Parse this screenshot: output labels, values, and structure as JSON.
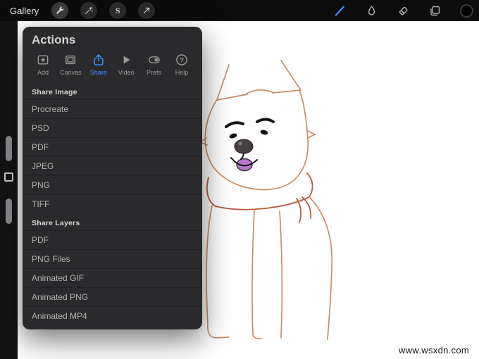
{
  "topbar": {
    "gallery_label": "Gallery",
    "left_tools": [
      "actions",
      "adjustments",
      "selection",
      "transform"
    ],
    "selection_glyph": "S",
    "right_tools": [
      "brush",
      "smudge",
      "eraser",
      "layers",
      "color"
    ]
  },
  "actions_panel": {
    "title": "Actions",
    "selected_tab": "Share",
    "tabs": [
      {
        "label": "Add"
      },
      {
        "label": "Canvas"
      },
      {
        "label": "Share"
      },
      {
        "label": "Video"
      },
      {
        "label": "Prefs"
      },
      {
        "label": "Help"
      }
    ],
    "share_image": {
      "header": "Share Image",
      "items": [
        "Procreate",
        "PSD",
        "PDF",
        "JPEG",
        "PNG",
        "TIFF"
      ]
    },
    "share_layers": {
      "header": "Share Layers",
      "items": [
        "PDF",
        "PNG Files",
        "Animated GIF",
        "Animated PNG",
        "Animated MP4"
      ]
    }
  },
  "canvas": {
    "watermark": "www.wsxdn.com",
    "drawing_description": "shiba-inu-line-art"
  },
  "colors": {
    "accent_blue": "#3f8cff",
    "outline_tan": "#c98f65",
    "scarf_red": "#b8593f",
    "tongue_purple": "#b678c8"
  }
}
